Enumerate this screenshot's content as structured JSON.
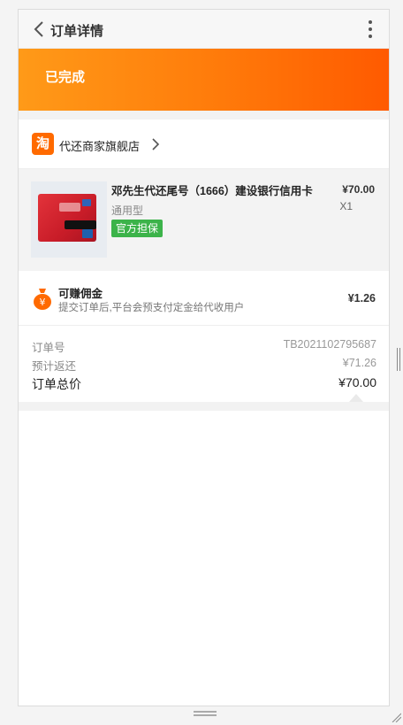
{
  "header": {
    "title": "订单详情",
    "back_icon": "chevron-left-icon",
    "more_icon": "more-vertical-icon"
  },
  "banner": {
    "status": "已完成",
    "colors": [
      "#ff9a18",
      "#ff5a00"
    ]
  },
  "store": {
    "logo_text": "淘",
    "name": "代还商家旗舰店"
  },
  "product": {
    "title": "邓先生代还尾号（1666）建设银行信用卡",
    "spec": "通用型",
    "badge": "官方担保",
    "price": "¥70.00",
    "quantity": "X1"
  },
  "commission": {
    "title": "可赚佣金",
    "description": "提交订单后,平台会预支付定金给代收用户",
    "amount": "¥1.26"
  },
  "summary": {
    "order_no_label": "订单号",
    "order_no": "TB2021102795687",
    "rebate_label": "预计返还",
    "rebate": "¥71.26",
    "total_label": "订单总价",
    "total": "¥70.00"
  }
}
